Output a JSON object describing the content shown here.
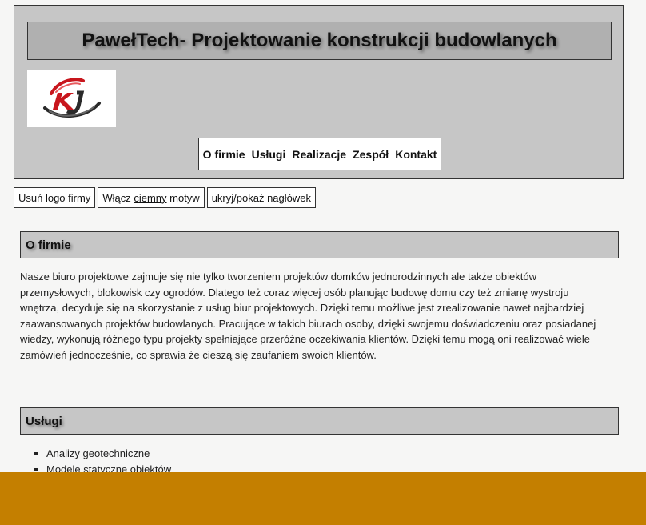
{
  "header": {
    "title": "PawełTech- Projektowanie konstrukcji budowlanych",
    "logo_icon": "kj-logo-icon",
    "nav": [
      "O firmie",
      "Usługi",
      "Realizacje",
      "Zespół",
      "Kontakt"
    ]
  },
  "controls": {
    "remove_logo": "Usuń logo firmy",
    "dark_prefix": "Włącz",
    "dark_word": "ciemny",
    "dark_suffix": "motyw",
    "toggle_header": "ukryj/pokaż nagłówek"
  },
  "about": {
    "heading": "O firmie",
    "text": "Nasze biuro projektowe zajmuje się nie tylko tworzeniem projektów domków jednorodzinnych ale także obiektów przemysłowych, blokowisk czy ogrodów. Dlatego też coraz więcej osób planując budowę domu czy też zmianę wystroju wnętrza, decyduje się na skorzystanie z usług biur projektowych. Dzięki temu możliwe jest zrealizowanie nawet najbardziej zaawansowanych projektów budowlanych. Pracujące w takich biurach osoby, dzięki swojemu doświadczeniu oraz posiadanej wiedzy, wykonują różnego typu projekty spełniające przeróżne oczekiwania klientów. Dzięki temu mogą oni realizować wiele zamówień jednocześnie, co sprawia że cieszą się zaufaniem swoich klientów."
  },
  "services": {
    "heading": "Usługi",
    "items": [
      "Analizy geotechniczne",
      "Modele statyczne obiektów"
    ]
  },
  "colors": {
    "bottom_bar": "#c47f00",
    "header_bg": "#c6c6c6",
    "title_bg": "#b0b0b0"
  }
}
